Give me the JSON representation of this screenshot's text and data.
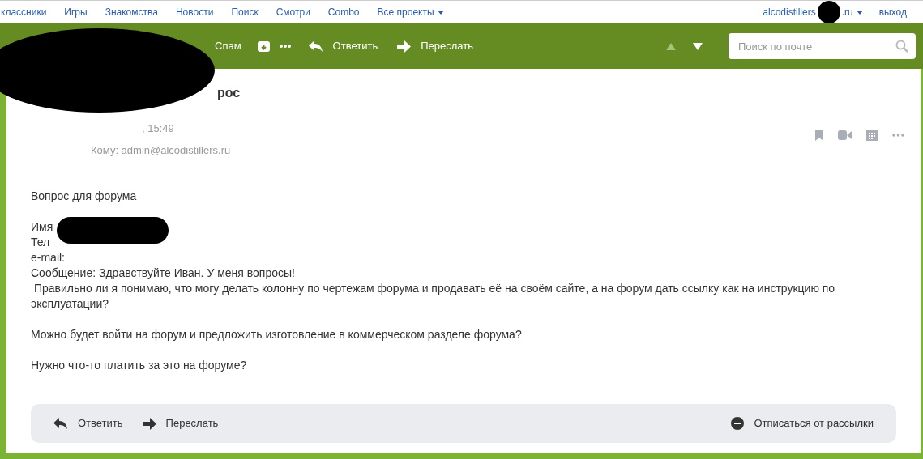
{
  "top_nav": {
    "links": [
      "классники",
      "Игры",
      "Знакомства",
      "Новости",
      "Поиск",
      "Смотри",
      "Combo"
    ],
    "projects_menu": "Все проекты",
    "account": {
      "email_start": "alcodistillers",
      "email_end": ".ru"
    },
    "logout": "выход"
  },
  "toolbar": {
    "spam": "Спам",
    "reply": "Ответить",
    "forward": "Переслать",
    "search": {
      "placeholder": "Поиск по почте"
    }
  },
  "message": {
    "subject_visible": "рос",
    "date_visible": ", 15:49",
    "to": "Кому: admin@alcodistillers.ru",
    "body": [
      {
        "kind": "line",
        "text": "Вопрос для форума"
      },
      {
        "kind": "gap"
      },
      {
        "kind": "line",
        "text": "Имя"
      },
      {
        "kind": "line",
        "text": "Тел"
      },
      {
        "kind": "line",
        "text": "e-mail:"
      },
      {
        "kind": "line",
        "text": "Сообщение: Здравствуйте Иван. У меня вопросы!"
      },
      {
        "kind": "line",
        "text": " Правильно ли я понимаю, что могу делать колонну по чертежам форума и продавать её на своём сайте, а на форум дать ссылку как на инструкцию по эксплуатации?"
      },
      {
        "kind": "gap"
      },
      {
        "kind": "line",
        "text": "Можно будет войти на форум и предложить изготовление в коммерческом разделе форума?"
      },
      {
        "kind": "gap"
      },
      {
        "kind": "line",
        "text": "Нужно что-то платить за это на форуме?"
      }
    ]
  },
  "footer": {
    "reply": "Ответить",
    "forward": "Переслать",
    "unsubscribe": "Отписаться от рассылки"
  }
}
